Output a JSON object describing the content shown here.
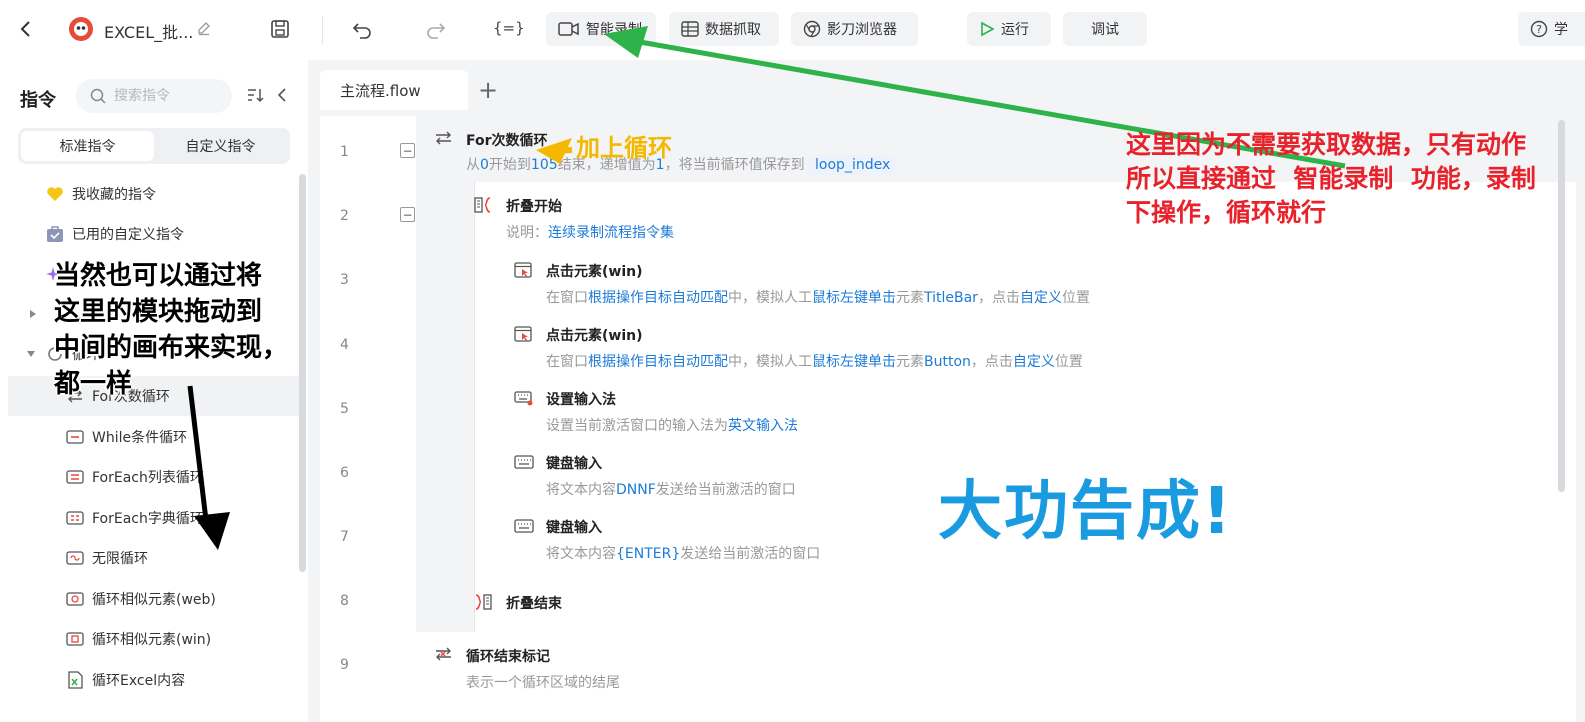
{
  "toolbar": {
    "title": "EXCEL_批...",
    "record_label": "智能录制",
    "scrape_label": "数据抓取",
    "browser_label": "影刀浏览器",
    "run_label": "运行",
    "debug_label": "调试",
    "help_label": "学"
  },
  "sidebar": {
    "title": "指令",
    "search_placeholder": "搜索指令",
    "tab_standard": "标准指令",
    "tab_custom": "自定义指令",
    "items": [
      {
        "label": "我收藏的指令",
        "icon": "heart-icon"
      },
      {
        "label": "已用的自定义指令",
        "icon": "briefcase-icon"
      },
      {
        "label": "循环",
        "icon": "loop-icon"
      },
      {
        "label": "For次数循环",
        "icon": "for-loop-icon"
      },
      {
        "label": "While条件循环",
        "icon": "while-loop-icon"
      },
      {
        "label": "ForEach列表循环",
        "icon": "foreach-list-icon"
      },
      {
        "label": "ForEach字典循环",
        "icon": "foreach-dict-icon"
      },
      {
        "label": "无限循环",
        "icon": "infinite-loop-icon"
      },
      {
        "label": "循环相似元素(web)",
        "icon": "loop-web-icon"
      },
      {
        "label": "循环相似元素(win)",
        "icon": "loop-win-icon"
      },
      {
        "label": "循环Excel内容",
        "icon": "loop-excel-icon"
      }
    ]
  },
  "editor": {
    "tab_label": "主流程.flow",
    "add_tab": "+",
    "line_numbers": [
      "1",
      "2",
      "3",
      "4",
      "5",
      "6",
      "7",
      "8",
      "9"
    ],
    "steps": {
      "s1": {
        "title": "For次数循环",
        "d1": "从",
        "d2": "0",
        "d3": "开始到",
        "d4": "105",
        "d5": "结束，递增值为",
        "d6": "1",
        "d7": "，将当前循环值保存到",
        "tag": "loop_index"
      },
      "s2": {
        "title": "折叠开始",
        "d1": "说明：",
        "d2": "连续录制流程指令集"
      },
      "s3": {
        "title": "点击元素(win)",
        "d1": "在窗口",
        "d2": "根据操作目标自动匹配",
        "d3": "中，模拟人工",
        "d4": "鼠标左键单击",
        "d5": "元素",
        "d6": "TitleBar",
        "d7": "，点击",
        "d8": "自定义",
        "d9": "位置"
      },
      "s4": {
        "title": "点击元素(win)",
        "d1": "在窗口",
        "d2": "根据操作目标自动匹配",
        "d3": "中，模拟人工",
        "d4": "鼠标左键单击",
        "d5": "元素",
        "d6": "Button",
        "d7": "，点击",
        "d8": "自定义",
        "d9": "位置"
      },
      "s5": {
        "title": "设置输入法",
        "d1": "设置当前激活窗口的输入法为",
        "d2": "英文输入法"
      },
      "s6": {
        "title": "键盘输入",
        "d1": "将文本内容",
        "d2": "DNNF",
        "d3": "发送给当前激活的窗口"
      },
      "s7": {
        "title": "键盘输入",
        "d1": "将文本内容",
        "d2": "{ENTER}",
        "d3": "发送给当前激活的窗口"
      },
      "s8": {
        "title": "折叠结束"
      },
      "s9": {
        "title": "循环结束标记",
        "d1": "表示一个循环区域的结尾"
      }
    }
  },
  "annotations": {
    "red": [
      "这里因为不需要获取数据，只有动作",
      "所以直接通过  智能录制  功能，录制",
      "下操作，循环就行"
    ],
    "black": [
      "当然也可以通过将",
      "这里的模块拖动到",
      "中间的画布来实现，",
      "都一样"
    ],
    "yellow": "加上循环",
    "big": "大功告成!"
  },
  "colors": {
    "accent_blue": "#1c7bd8",
    "annotation_red": "#e8222a",
    "annotation_yellow": "#f5b800",
    "annotation_big": "#1a9be0",
    "arrow_green": "#2db34a"
  }
}
